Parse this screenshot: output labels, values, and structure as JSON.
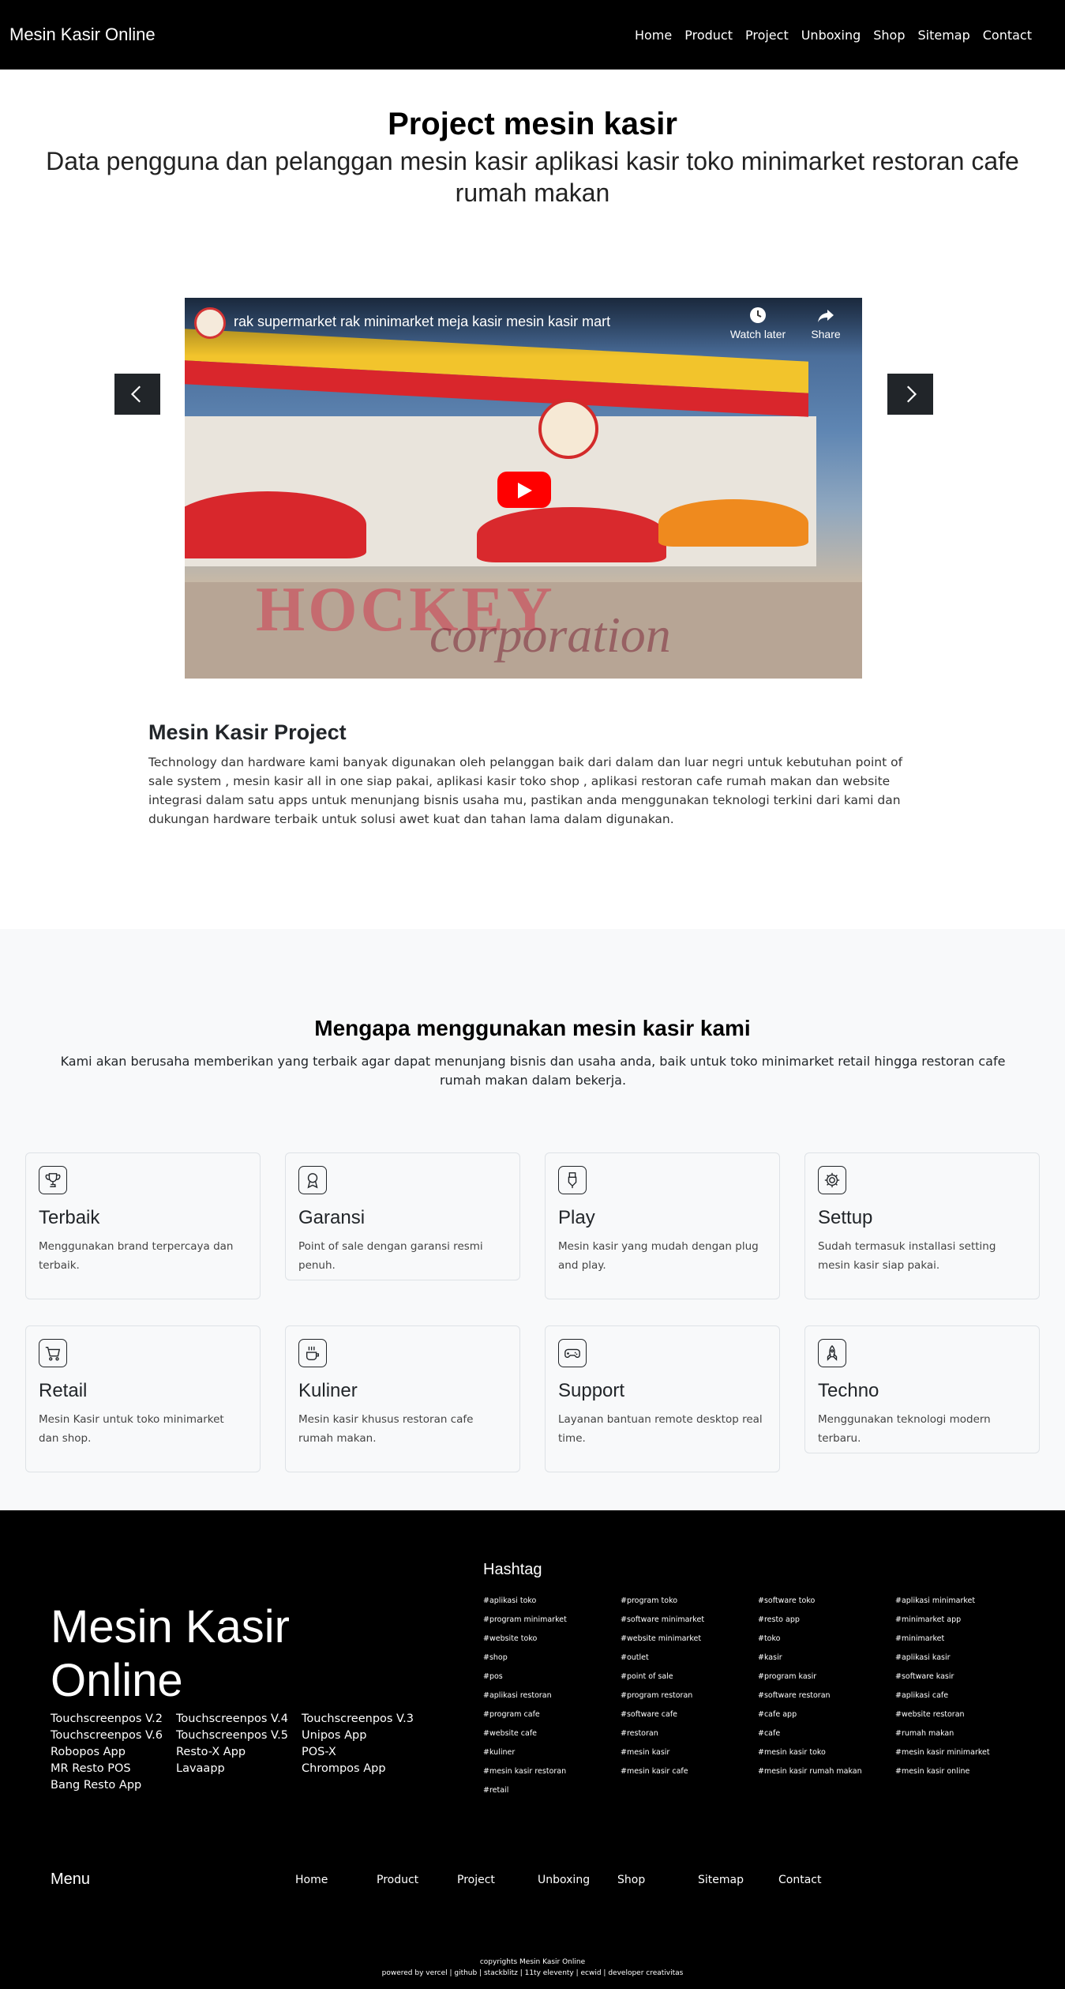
{
  "nav": {
    "brand": "Mesin Kasir Online",
    "links": [
      "Home",
      "Product",
      "Project",
      "Unboxing",
      "Shop",
      "Sitemap",
      "Contact"
    ]
  },
  "hero": {
    "title": "Project mesin kasir",
    "subtitle": "Data pengguna dan pelanggan mesin kasir aplikasi kasir toko minimarket restoran cafe rumah makan"
  },
  "video": {
    "title": "rak supermarket rak minimarket meja kasir mesin kasir mart",
    "watch_later": "Watch later",
    "share": "Share",
    "watermark_1": "HOCKEY",
    "watermark_2": "corporation"
  },
  "project": {
    "title": "Mesin Kasir Project",
    "text": "Technology dan hardware kami banyak digunakan oleh pelanggan baik dari dalam dan luar negri untuk kebutuhan point of sale system , mesin kasir all in one siap pakai, aplikasi kasir toko shop , aplikasi restoran cafe rumah makan dan website integrasi dalam satu apps untuk menunjang bisnis usaha mu, pastikan anda menggunakan teknologi terkini dari kami dan dukungan hardware terbaik untuk solusi awet kuat dan tahan lama dalam digunakan."
  },
  "features": {
    "title": "Mengapa menggunakan mesin kasir kami",
    "subtitle": "Kami akan berusaha memberikan yang terbaik agar dapat menunjang bisnis dan usaha anda, baik untuk toko minimarket retail hingga restoran cafe rumah makan dalam bekerja.",
    "cards": [
      {
        "title": "Terbaik",
        "text": "Menggunakan brand terpercaya dan terbaik.",
        "icon": "trophy-icon"
      },
      {
        "title": "Garansi",
        "text": "Point of sale dengan garansi resmi penuh.",
        "icon": "award-icon"
      },
      {
        "title": "Play",
        "text": "Mesin kasir yang mudah dengan plug and play.",
        "icon": "usb-plug-icon"
      },
      {
        "title": "Settup",
        "text": "Sudah termasuk installasi setting mesin kasir siap pakai.",
        "icon": "gear-icon"
      },
      {
        "title": "Retail",
        "text": "Mesin Kasir untuk toko minimarket dan shop.",
        "icon": "cart-icon"
      },
      {
        "title": "Kuliner",
        "text": "Mesin kasir khusus restoran cafe rumah makan.",
        "icon": "cup-hot-icon"
      },
      {
        "title": "Support",
        "text": "Layanan bantuan remote desktop real time.",
        "icon": "controller-icon"
      },
      {
        "title": "Techno",
        "text": "Menggunakan teknologi modern terbaru.",
        "icon": "rocket-icon"
      }
    ]
  },
  "footer": {
    "brand": "Mesin Kasir Online",
    "apps": [
      [
        "Touchscreenpos V.2",
        "Touchscreenpos V.6",
        "Robopos App",
        "MR Resto POS",
        "Bang Resto App"
      ],
      [
        "Touchscreenpos V.4",
        "Touchscreenpos V.5",
        "Resto-X App",
        "Lavaapp"
      ],
      [
        "Touchscreenpos V.3",
        "Unipos App",
        "POS-X",
        "Chrompos App"
      ]
    ],
    "hashtag_title": "Hashtag",
    "tags": [
      "#aplikasi toko",
      "#program toko",
      "#software toko",
      "#aplikasi minimarket",
      "#program minimarket",
      "#software minimarket",
      "#resto app",
      "#minimarket app",
      "#website toko",
      "#website minimarket",
      "#toko",
      "#minimarket",
      "#shop",
      "#outlet",
      "#kasir",
      "#aplikasi kasir",
      "#pos",
      "#point of sale",
      "#program kasir",
      "#software kasir",
      "#aplikasi restoran",
      "#program restoran",
      "#software restoran",
      "#aplikasi cafe",
      "#program cafe",
      "#software cafe",
      "#cafe app",
      "#website restoran",
      "#website cafe",
      "#restoran",
      "#cafe",
      "#rumah makan",
      "#kuliner",
      "#mesin kasir",
      "#mesin kasir toko",
      "#mesin kasir minimarket",
      "#mesin kasir restoran",
      "#mesin kasir cafe",
      "#mesin kasir rumah makan",
      "#mesin kasir online",
      "#retail"
    ],
    "menu_title": "Menu",
    "menu": [
      "Home",
      "Product",
      "Project",
      "Unboxing",
      "Shop",
      "Sitemap",
      "Contact"
    ],
    "copyright": "copyrights Mesin Kasir Online",
    "powered": "powered by vercel | github | stackblitz | 11ty eleventy | ecwid | developer creativitas"
  }
}
